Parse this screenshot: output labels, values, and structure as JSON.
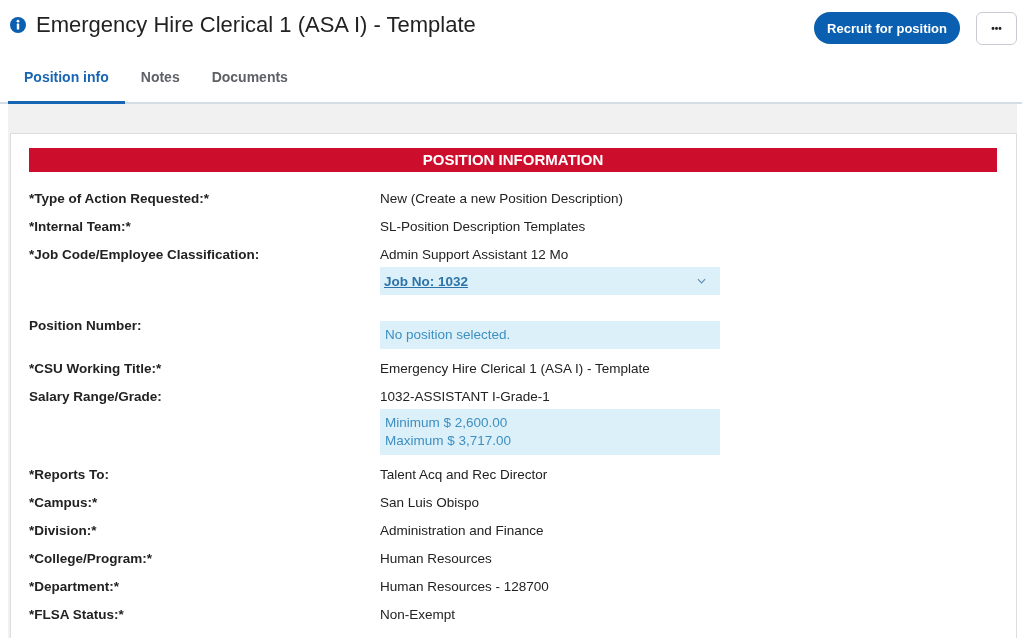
{
  "title": "Emergency Hire Clerical 1 (ASA I) - Template",
  "actions": {
    "primary": "Recruit for position",
    "more": "•••"
  },
  "tabs": [
    {
      "label": "Position info",
      "selected": true
    },
    {
      "label": "Notes",
      "selected": false
    },
    {
      "label": "Documents",
      "selected": false
    }
  ],
  "section": {
    "heading": "POSITION INFORMATION",
    "rows": [
      {
        "label": "*Type of Action Requested:*",
        "value": "New (Create a new Position Description)"
      },
      {
        "label": "*Internal Team:*",
        "value": "SL-Position Description Templates"
      },
      {
        "label": "*Job Code/Employee Classification:",
        "value": "Admin Support Assistant 12 Mo",
        "dropdown": {
          "text": "Job No: 1032",
          "expanded": false
        }
      },
      {
        "label": "Position Number:",
        "note_lines": [
          "No position selected."
        ]
      },
      {
        "label": "*CSU Working Title:*",
        "value": "Emergency Hire Clerical 1 (ASA I) - Template"
      },
      {
        "label": "Salary Range/Grade:",
        "value": "1032-ASSISTANT I-Grade-1",
        "note_lines": [
          "Minimum $ 2,600.00",
          "Maximum $ 3,717.00"
        ]
      },
      {
        "label": "*Reports To:",
        "value": "Talent Acq and Rec Director"
      },
      {
        "label": "*Campus:*",
        "value": "San Luis Obispo"
      },
      {
        "label": "*Division:*",
        "value": "Administration and Finance"
      },
      {
        "label": "*College/Program:*",
        "value": "Human Resources"
      },
      {
        "label": "*Department:*",
        "value": "Human Resources - 128700"
      },
      {
        "label": "*FLSA Status:*",
        "value": "Non-Exempt"
      }
    ]
  }
}
